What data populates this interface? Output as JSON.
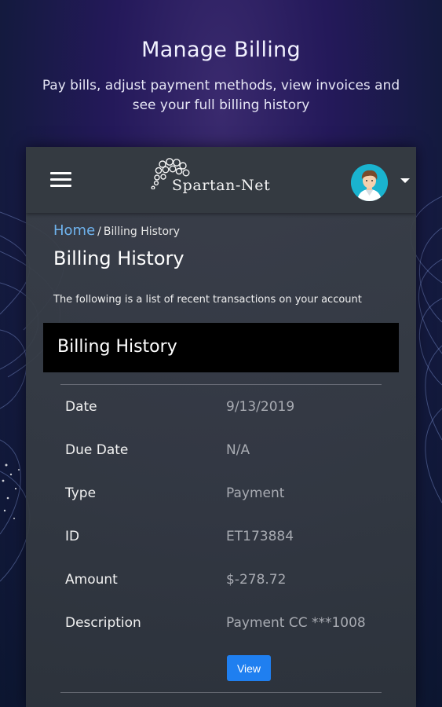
{
  "promo": {
    "title": "Manage Billing",
    "subtitle": "Pay bills, adjust payment methods, view invoices and see your full billing history"
  },
  "app": {
    "logo_text": "Spartan-Net",
    "menu_icon": "hamburger-icon",
    "avatar_icon": "user-avatar",
    "dropdown_icon": "caret-down-icon"
  },
  "breadcrumb": {
    "home": "Home",
    "separator": "/",
    "current": "Billing History"
  },
  "page": {
    "title": "Billing History",
    "intro": "The following is a list of recent transactions on your account"
  },
  "card": {
    "title": "Billing History",
    "rows": [
      {
        "label": "Date",
        "value": "9/13/2019"
      },
      {
        "label": "Due Date",
        "value": "N/A"
      },
      {
        "label": "Type",
        "value": "Payment"
      },
      {
        "label": "ID",
        "value": "ET173884"
      },
      {
        "label": "Amount",
        "value": "$-278.72"
      },
      {
        "label": "Description",
        "value": "Payment CC ***1008"
      }
    ],
    "view_label": "View"
  },
  "colors": {
    "link": "#6fb3ee",
    "primary_button": "#1f7ff0",
    "card_header": "#000000",
    "avatar_bg": "#1ab3cf"
  }
}
